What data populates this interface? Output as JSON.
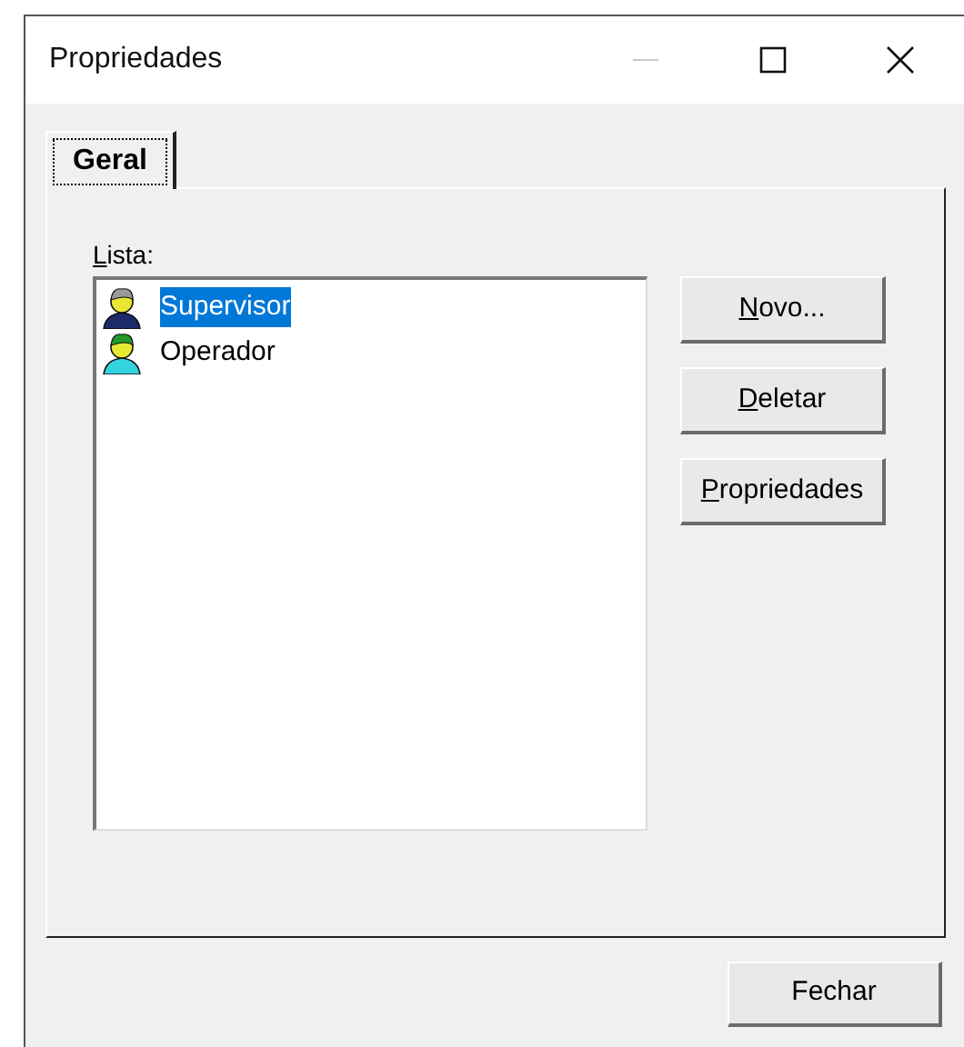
{
  "window": {
    "title": "Propriedades",
    "controls": [
      {
        "kind": "minimize",
        "disabled": true
      },
      {
        "kind": "maximize",
        "disabled": false
      },
      {
        "kind": "close",
        "disabled": false
      }
    ]
  },
  "tabs": [
    {
      "label": "Geral",
      "selected": true
    }
  ],
  "list": {
    "label": "Lista:",
    "first_letter_underlined": true,
    "items": [
      {
        "label": "Supervisor",
        "kind": "supervisor",
        "selected": true
      },
      {
        "label": "Operador",
        "kind": "operator",
        "selected": false
      }
    ]
  },
  "side_buttons": [
    {
      "label": "Novo...",
      "first_letter_underlined": true
    },
    {
      "label": "Deletar",
      "first_letter_underlined": true
    },
    {
      "label": "Propriedades",
      "first_letter_underlined": true
    }
  ],
  "footer_buttons": [
    {
      "label": "Fechar"
    }
  ]
}
